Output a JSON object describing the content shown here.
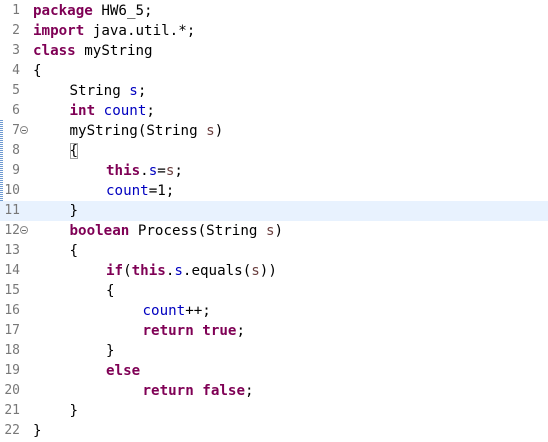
{
  "editor": {
    "current_line": 11,
    "lines": [
      {
        "n": "1",
        "fold": false,
        "indent": 0,
        "tokens": [
          {
            "t": "package",
            "c": "kw"
          },
          {
            "t": " HW6_5;",
            "c": "txt"
          }
        ]
      },
      {
        "n": "2",
        "fold": false,
        "indent": 0,
        "tokens": [
          {
            "t": "import",
            "c": "kw"
          },
          {
            "t": " java.util.*;",
            "c": "txt"
          }
        ]
      },
      {
        "n": "3",
        "fold": false,
        "indent": 0,
        "tokens": [
          {
            "t": "class",
            "c": "kw"
          },
          {
            "t": " myString",
            "c": "txt"
          }
        ]
      },
      {
        "n": "4",
        "fold": false,
        "indent": 0,
        "tokens": [
          {
            "t": "{",
            "c": "txt"
          }
        ]
      },
      {
        "n": "5",
        "fold": false,
        "indent": 1,
        "tokens": [
          {
            "t": "String ",
            "c": "txt"
          },
          {
            "t": "s",
            "c": "fld"
          },
          {
            "t": ";",
            "c": "txt"
          }
        ]
      },
      {
        "n": "6",
        "fold": false,
        "indent": 1,
        "tokens": [
          {
            "t": "int",
            "c": "kw"
          },
          {
            "t": " ",
            "c": "txt"
          },
          {
            "t": "count",
            "c": "fld"
          },
          {
            "t": ";",
            "c": "txt"
          }
        ]
      },
      {
        "n": "7",
        "fold": true,
        "indent": 1,
        "tokens": [
          {
            "t": "myString(String ",
            "c": "txt"
          },
          {
            "t": "s",
            "c": "var"
          },
          {
            "t": ")",
            "c": "txt"
          }
        ]
      },
      {
        "n": "8",
        "fold": false,
        "indent": 1,
        "tokens": [
          {
            "t": "{",
            "c": "bracket"
          }
        ]
      },
      {
        "n": "9",
        "fold": false,
        "indent": 2,
        "tokens": [
          {
            "t": "this",
            "c": "kw"
          },
          {
            "t": ".",
            "c": "txt"
          },
          {
            "t": "s",
            "c": "fld"
          },
          {
            "t": "=",
            "c": "txt"
          },
          {
            "t": "s",
            "c": "var"
          },
          {
            "t": ";",
            "c": "txt"
          }
        ]
      },
      {
        "n": "10",
        "fold": false,
        "indent": 2,
        "tokens": [
          {
            "t": "count",
            "c": "fld"
          },
          {
            "t": "=1;",
            "c": "txt"
          }
        ]
      },
      {
        "n": "11",
        "fold": false,
        "indent": 1,
        "tokens": [
          {
            "t": "}",
            "c": "txt"
          }
        ]
      },
      {
        "n": "12",
        "fold": true,
        "indent": 1,
        "tokens": [
          {
            "t": "boolean",
            "c": "kw"
          },
          {
            "t": " Process(String ",
            "c": "txt"
          },
          {
            "t": "s",
            "c": "var"
          },
          {
            "t": ")",
            "c": "txt"
          }
        ]
      },
      {
        "n": "13",
        "fold": false,
        "indent": 1,
        "tokens": [
          {
            "t": "{",
            "c": "txt"
          }
        ]
      },
      {
        "n": "14",
        "fold": false,
        "indent": 2,
        "tokens": [
          {
            "t": "if",
            "c": "kw"
          },
          {
            "t": "(",
            "c": "txt"
          },
          {
            "t": "this",
            "c": "kw"
          },
          {
            "t": ".",
            "c": "txt"
          },
          {
            "t": "s",
            "c": "fld"
          },
          {
            "t": ".equals(",
            "c": "txt"
          },
          {
            "t": "s",
            "c": "var"
          },
          {
            "t": "))",
            "c": "txt"
          }
        ]
      },
      {
        "n": "15",
        "fold": false,
        "indent": 2,
        "tokens": [
          {
            "t": "{",
            "c": "txt"
          }
        ]
      },
      {
        "n": "16",
        "fold": false,
        "indent": 3,
        "tokens": [
          {
            "t": "count",
            "c": "fld"
          },
          {
            "t": "++;",
            "c": "txt"
          }
        ]
      },
      {
        "n": "17",
        "fold": false,
        "indent": 3,
        "tokens": [
          {
            "t": "return",
            "c": "kw"
          },
          {
            "t": " ",
            "c": "txt"
          },
          {
            "t": "true",
            "c": "kw"
          },
          {
            "t": ";",
            "c": "txt"
          }
        ]
      },
      {
        "n": "18",
        "fold": false,
        "indent": 2,
        "tokens": [
          {
            "t": "}",
            "c": "txt"
          }
        ]
      },
      {
        "n": "19",
        "fold": false,
        "indent": 2,
        "tokens": [
          {
            "t": "else",
            "c": "kw"
          }
        ]
      },
      {
        "n": "20",
        "fold": false,
        "indent": 3,
        "tokens": [
          {
            "t": "return",
            "c": "kw"
          },
          {
            "t": " ",
            "c": "txt"
          },
          {
            "t": "false",
            "c": "kw"
          },
          {
            "t": ";",
            "c": "txt"
          }
        ]
      },
      {
        "n": "21",
        "fold": false,
        "indent": 1,
        "tokens": [
          {
            "t": "}",
            "c": "txt"
          }
        ]
      },
      {
        "n": "22",
        "fold": false,
        "indent": 0,
        "tokens": [
          {
            "t": "}",
            "c": "txt"
          }
        ]
      }
    ]
  }
}
